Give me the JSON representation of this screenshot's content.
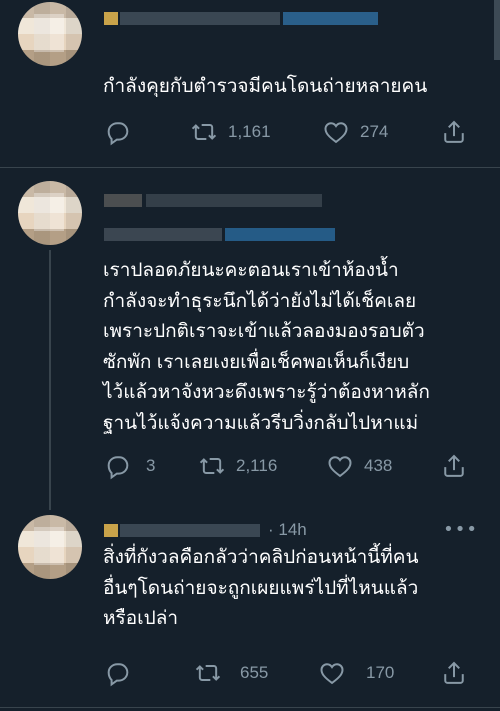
{
  "tweets": [
    {
      "text": "กำลังคุยกับตำรวจมีคนโดนถ่ายหลายคน",
      "reply_count": "",
      "retweet_count": "1,161",
      "like_count": "274"
    },
    {
      "text": "เราปลอดภัยนะคะตอนเราเข้าห้องน้ำ\nกำลังจะทำธุระนึกได้ว่ายังไม่ได้เช็คเลย\nเพราะปกติเราจะเข้าแล้วลองมองรอบตัว\nซักพัก เราเลยเงยเพื่อเช็คพอเห็นก็เงียบ\nไว้แล้วหาจังหวะดึงเพราะรู้ว่าต้องหาหลัก\nฐานไว้แจ้งความแล้วรีบวิ่งกลับไปหาแม่",
      "reply_count": "3",
      "retweet_count": "2,116",
      "like_count": "438"
    },
    {
      "timestamp": "· 14h",
      "text": "สิ่งที่กังวลคือกลัวว่าคลิปก่อนหน้านี้ที่คน\nอื่นๆโดนถ่ายจะถูกเผยแพร่ไปที่ไหนแล้ว\nหรือเปล่า",
      "reply_count": "",
      "retweet_count": "655",
      "like_count": "170"
    }
  ],
  "icons": {
    "reply": "reply-icon",
    "retweet": "retweet-icon",
    "like": "heart-icon",
    "share": "share-icon",
    "more": "more-icon"
  },
  "colors": {
    "background": "#15202b",
    "secondary_text": "#8899a6",
    "divider": "#38444d",
    "link_blue": "#1d9bf0"
  }
}
